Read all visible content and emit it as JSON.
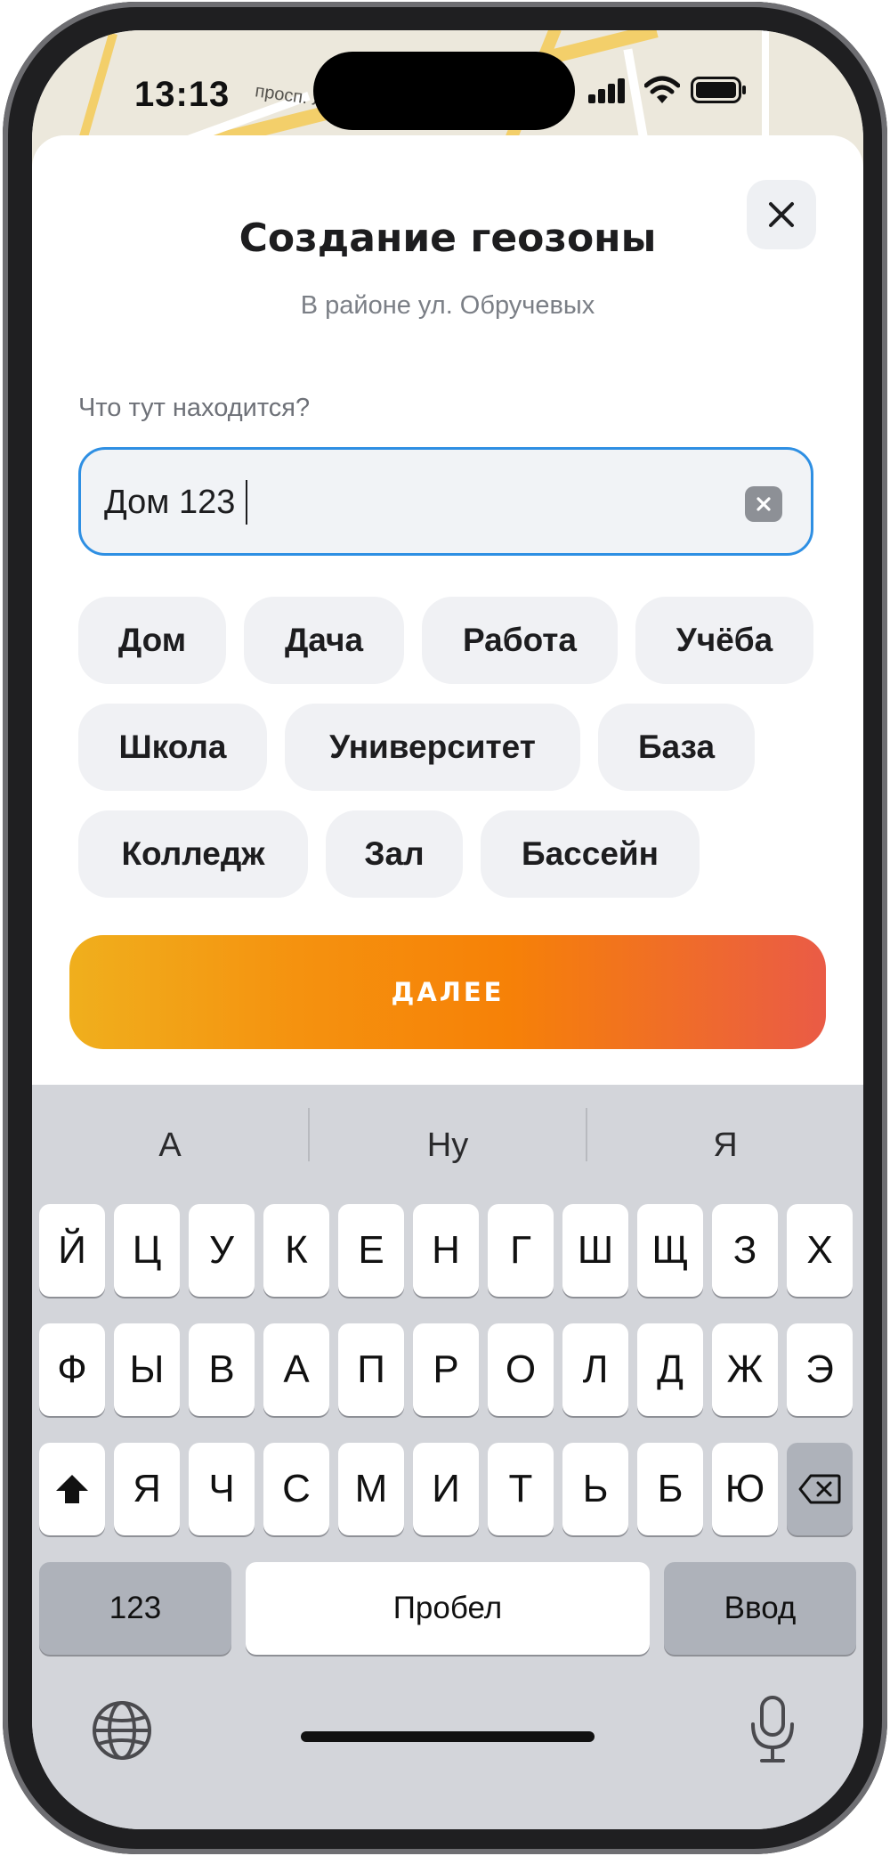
{
  "status_bar": {
    "time": "13:13"
  },
  "map": {
    "street_label": "просп. Лунач."
  },
  "sheet": {
    "title": "Создание геозоны",
    "subtitle": "В районе ул. Обручевых",
    "field_label": "Что тут находится?",
    "input_value": "Дом 123",
    "chips": [
      "Дом",
      "Дача",
      "Работа",
      "Учёба",
      "Школа",
      "Университет",
      "База",
      "Колледж",
      "Зал",
      "Бассейн"
    ],
    "next_button": "ДАЛЕЕ"
  },
  "keyboard": {
    "suggestions": [
      "А",
      "Ну",
      "Я"
    ],
    "row1": [
      "Й",
      "Ц",
      "У",
      "К",
      "Е",
      "Н",
      "Г",
      "Ш",
      "Щ",
      "З",
      "Х"
    ],
    "row2": [
      "Ф",
      "Ы",
      "В",
      "А",
      "П",
      "Р",
      "О",
      "Л",
      "Д",
      "Ж",
      "Э"
    ],
    "row3": [
      "Я",
      "Ч",
      "С",
      "М",
      "И",
      "Т",
      "Ь",
      "Б",
      "Ю"
    ],
    "numbers_key": "123",
    "space_key": "Пробел",
    "return_key": "Ввод",
    "icons": [
      "shift-icon",
      "backspace-icon",
      "globe-icon",
      "microphone-icon"
    ]
  },
  "colors": {
    "accent_blue": "#2e8fe3",
    "button_gradient": [
      "#f0af1d",
      "#f68107",
      "#ea5b46"
    ],
    "chip_bg": "#f0f1f4"
  }
}
